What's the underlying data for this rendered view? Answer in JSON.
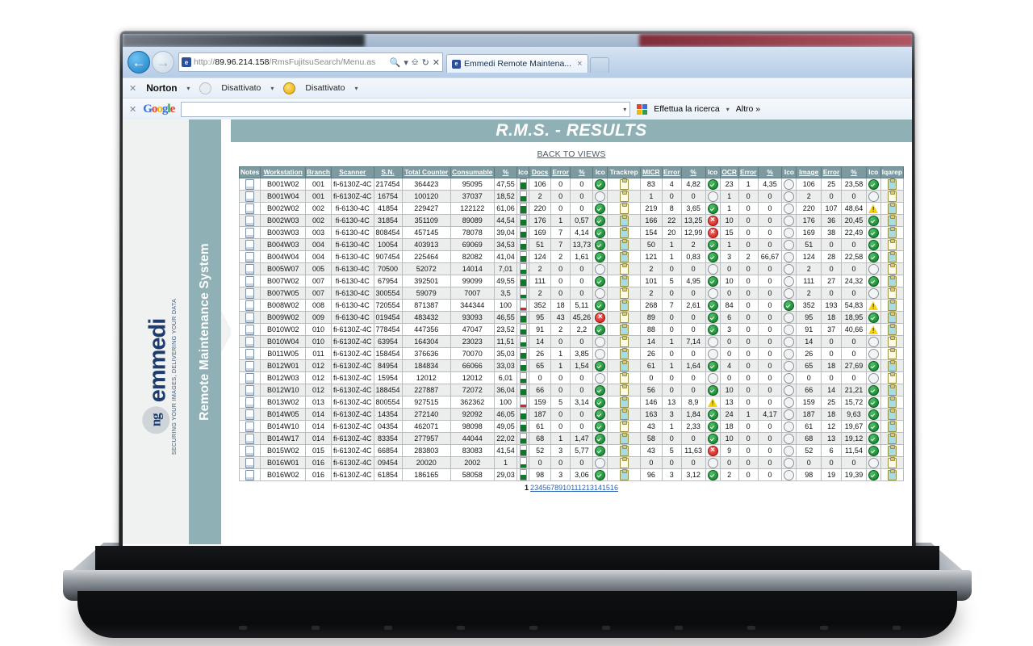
{
  "browser": {
    "address_url_prefix": "http://",
    "address_url_host": "89.96.214.158",
    "address_url_path": "/RmsFujitsuSearch/Menu.as",
    "tab_title": "Emmedi Remote Maintena...",
    "tab_close": "×",
    "nav_back": "←",
    "nav_forward": "→",
    "addr_search_icon": "search-icon",
    "addr_compat_icon": "compatibility-icon",
    "addr_refresh_icon": "↻",
    "addr_stop_icon": "✕",
    "norton": {
      "close": "✕",
      "brand": "Norton",
      "brand_o": "o",
      "brand_tail": "rton",
      "item1": "Disattivato",
      "item2": "Disattivato",
      "caret": "▾"
    },
    "google": {
      "close": "✕",
      "logo_g1": "G",
      "logo_o1": "o",
      "logo_o2": "o",
      "logo_g2": "g",
      "logo_l": "l",
      "logo_e": "e",
      "search_value": "",
      "search_placeholder": "",
      "dropdown_caret": "▾",
      "search_button": "Effettua la ricerca",
      "more": "Altro »"
    }
  },
  "sidebar": {
    "logo_mark": "ng",
    "logo_text": "emmedi",
    "tagline": "SECURING YOUR IMAGES, DELIVERING YOUR DATA",
    "rail_label": "Remote Maintenance System"
  },
  "page": {
    "title": "R.M.S. - RESULTS",
    "back_link": "BACK TO VIEWS"
  },
  "table": {
    "headers": [
      "Notes",
      "Workstation",
      "Branch",
      "Scanner",
      "S.N.",
      "Total Counter",
      "Consumable",
      "%",
      "Ico",
      "Docs",
      "Error",
      "%",
      "Ico",
      "Trackrep",
      "MICR",
      "Error",
      "%",
      "Ico",
      "OCR",
      "Error",
      "%",
      "Ico",
      "Image",
      "Error",
      "%",
      "Ico",
      "Iqarep"
    ],
    "rows": [
      {
        "ws": "B001W02",
        "branch": "001",
        "scanner": "fi-6130Z-4C",
        "sn": "217454",
        "total": "364423",
        "cons": "95095",
        "cons_pct": "47,55",
        "gauge": "green",
        "docs": "106",
        "docs_err": "0",
        "docs_pct": "0",
        "docs_ico": "ok",
        "trackrep": "tan",
        "micr": "83",
        "micr_err": "4",
        "micr_pct": "4,82",
        "micr_ico": "ok",
        "ocr": "23",
        "ocr_err": "1",
        "ocr_pct": "4,35",
        "ocr_ico": "none",
        "img": "106",
        "img_err": "25",
        "img_pct": "23,58",
        "img_ico": "ok",
        "iqarep": "filled"
      },
      {
        "ws": "B001W04",
        "branch": "001",
        "scanner": "fi-6130Z-4C",
        "sn": "16754",
        "total": "100120",
        "cons": "37037",
        "cons_pct": "18,52",
        "gauge": "green",
        "docs": "2",
        "docs_err": "0",
        "docs_pct": "0",
        "docs_ico": "none",
        "trackrep": "tan",
        "micr": "1",
        "micr_err": "0",
        "micr_pct": "0",
        "micr_ico": "none",
        "ocr": "1",
        "ocr_err": "0",
        "ocr_pct": "0",
        "ocr_ico": "none",
        "img": "2",
        "img_err": "0",
        "img_pct": "0",
        "img_ico": "none",
        "iqarep": "tan"
      },
      {
        "ws": "B002W02",
        "branch": "002",
        "scanner": "fi-6130-4C",
        "sn": "41854",
        "total": "229427",
        "cons": "122122",
        "cons_pct": "61,06",
        "gauge": "green",
        "docs": "220",
        "docs_err": "0",
        "docs_pct": "0",
        "docs_ico": "ok",
        "trackrep": "tan",
        "micr": "219",
        "micr_err": "8",
        "micr_pct": "3,65",
        "micr_ico": "ok",
        "ocr": "1",
        "ocr_err": "0",
        "ocr_pct": "0",
        "ocr_ico": "none",
        "img": "220",
        "img_err": "107",
        "img_pct": "48,64",
        "img_ico": "warn",
        "iqarep": "filled"
      },
      {
        "ws": "B002W03",
        "branch": "002",
        "scanner": "fi-6130-4C",
        "sn": "31854",
        "total": "351109",
        "cons": "89089",
        "cons_pct": "44,54",
        "gauge": "green",
        "docs": "176",
        "docs_err": "1",
        "docs_pct": "0,57",
        "docs_ico": "ok",
        "trackrep": "filled",
        "micr": "166",
        "micr_err": "22",
        "micr_pct": "13,25",
        "micr_ico": "err",
        "ocr": "10",
        "ocr_err": "0",
        "ocr_pct": "0",
        "ocr_ico": "none",
        "img": "176",
        "img_err": "36",
        "img_pct": "20,45",
        "img_ico": "ok",
        "iqarep": "filled"
      },
      {
        "ws": "B003W03",
        "branch": "003",
        "scanner": "fi-6130-4C",
        "sn": "808454",
        "total": "457145",
        "cons": "78078",
        "cons_pct": "39,04",
        "gauge": "green",
        "docs": "169",
        "docs_err": "7",
        "docs_pct": "4,14",
        "docs_ico": "ok",
        "trackrep": "filled",
        "micr": "154",
        "micr_err": "20",
        "micr_pct": "12,99",
        "micr_ico": "err",
        "ocr": "15",
        "ocr_err": "0",
        "ocr_pct": "0",
        "ocr_ico": "none",
        "img": "169",
        "img_err": "38",
        "img_pct": "22,49",
        "img_ico": "ok",
        "iqarep": "filled"
      },
      {
        "ws": "B004W03",
        "branch": "004",
        "scanner": "fi-6130-4C",
        "sn": "10054",
        "total": "403913",
        "cons": "69069",
        "cons_pct": "34,53",
        "gauge": "green",
        "docs": "51",
        "docs_err": "7",
        "docs_pct": "13,73",
        "docs_ico": "ok",
        "trackrep": "filled",
        "micr": "50",
        "micr_err": "1",
        "micr_pct": "2",
        "micr_ico": "ok",
        "ocr": "1",
        "ocr_err": "0",
        "ocr_pct": "0",
        "ocr_ico": "none",
        "img": "51",
        "img_err": "0",
        "img_pct": "0",
        "img_ico": "ok",
        "iqarep": "tan"
      },
      {
        "ws": "B004W04",
        "branch": "004",
        "scanner": "fi-6130-4C",
        "sn": "907454",
        "total": "225464",
        "cons": "82082",
        "cons_pct": "41,04",
        "gauge": "green",
        "docs": "124",
        "docs_err": "2",
        "docs_pct": "1,61",
        "docs_ico": "ok",
        "trackrep": "filled",
        "micr": "121",
        "micr_err": "1",
        "micr_pct": "0,83",
        "micr_ico": "ok",
        "ocr": "3",
        "ocr_err": "2",
        "ocr_pct": "66,67",
        "ocr_ico": "none",
        "img": "124",
        "img_err": "28",
        "img_pct": "22,58",
        "img_ico": "ok",
        "iqarep": "filled"
      },
      {
        "ws": "B005W07",
        "branch": "005",
        "scanner": "fi-6130-4C",
        "sn": "70500",
        "total": "52072",
        "cons": "14014",
        "cons_pct": "7,01",
        "gauge": "green",
        "docs": "2",
        "docs_err": "0",
        "docs_pct": "0",
        "docs_ico": "none",
        "trackrep": "tan",
        "micr": "2",
        "micr_err": "0",
        "micr_pct": "0",
        "micr_ico": "none",
        "ocr": "0",
        "ocr_err": "0",
        "ocr_pct": "0",
        "ocr_ico": "none",
        "img": "2",
        "img_err": "0",
        "img_pct": "0",
        "img_ico": "none",
        "iqarep": "tan"
      },
      {
        "ws": "B007W02",
        "branch": "007",
        "scanner": "fi-6130-4C",
        "sn": "67954",
        "total": "392501",
        "cons": "99099",
        "cons_pct": "49,55",
        "gauge": "green",
        "docs": "111",
        "docs_err": "0",
        "docs_pct": "0",
        "docs_ico": "ok",
        "trackrep": "filled",
        "micr": "101",
        "micr_err": "5",
        "micr_pct": "4,95",
        "micr_ico": "ok",
        "ocr": "10",
        "ocr_err": "0",
        "ocr_pct": "0",
        "ocr_ico": "none",
        "img": "111",
        "img_err": "27",
        "img_pct": "24,32",
        "img_ico": "ok",
        "iqarep": "filled"
      },
      {
        "ws": "B007W05",
        "branch": "007",
        "scanner": "fi-6130-4C",
        "sn": "300554",
        "total": "59079",
        "cons": "7007",
        "cons_pct": "3,5",
        "gauge": "green",
        "docs": "2",
        "docs_err": "0",
        "docs_pct": "0",
        "docs_ico": "none",
        "trackrep": "tan",
        "micr": "2",
        "micr_err": "0",
        "micr_pct": "0",
        "micr_ico": "none",
        "ocr": "0",
        "ocr_err": "0",
        "ocr_pct": "0",
        "ocr_ico": "none",
        "img": "2",
        "img_err": "0",
        "img_pct": "0",
        "img_ico": "none",
        "iqarep": "tan"
      },
      {
        "ws": "B008W02",
        "branch": "008",
        "scanner": "fi-6130-4C",
        "sn": "720554",
        "total": "871387",
        "cons": "344344",
        "cons_pct": "100",
        "gauge": "full",
        "docs": "352",
        "docs_err": "18",
        "docs_pct": "5,11",
        "docs_ico": "ok",
        "trackrep": "filled",
        "micr": "268",
        "micr_err": "7",
        "micr_pct": "2,61",
        "micr_ico": "ok",
        "ocr": "84",
        "ocr_err": "0",
        "ocr_pct": "0",
        "ocr_ico": "ok",
        "img": "352",
        "img_err": "193",
        "img_pct": "54,83",
        "img_ico": "warn",
        "iqarep": "filled"
      },
      {
        "ws": "B009W02",
        "branch": "009",
        "scanner": "fi-6130-4C",
        "sn": "019454",
        "total": "483432",
        "cons": "93093",
        "cons_pct": "46,55",
        "gauge": "green",
        "docs": "95",
        "docs_err": "43",
        "docs_pct": "45,26",
        "docs_ico": "err",
        "trackrep": "tan",
        "micr": "89",
        "micr_err": "0",
        "micr_pct": "0",
        "micr_ico": "ok",
        "ocr": "6",
        "ocr_err": "0",
        "ocr_pct": "0",
        "ocr_ico": "none",
        "img": "95",
        "img_err": "18",
        "img_pct": "18,95",
        "img_ico": "ok",
        "iqarep": "filled"
      },
      {
        "ws": "B010W02",
        "branch": "010",
        "scanner": "fi-6130Z-4C",
        "sn": "778454",
        "total": "447356",
        "cons": "47047",
        "cons_pct": "23,52",
        "gauge": "green",
        "docs": "91",
        "docs_err": "2",
        "docs_pct": "2,2",
        "docs_ico": "ok",
        "trackrep": "filled",
        "micr": "88",
        "micr_err": "0",
        "micr_pct": "0",
        "micr_ico": "ok",
        "ocr": "3",
        "ocr_err": "0",
        "ocr_pct": "0",
        "ocr_ico": "none",
        "img": "91",
        "img_err": "37",
        "img_pct": "40,66",
        "img_ico": "warn",
        "iqarep": "filled"
      },
      {
        "ws": "B010W04",
        "branch": "010",
        "scanner": "fi-6130Z-4C",
        "sn": "63954",
        "total": "164304",
        "cons": "23023",
        "cons_pct": "11,51",
        "gauge": "green",
        "docs": "14",
        "docs_err": "0",
        "docs_pct": "0",
        "docs_ico": "none",
        "trackrep": "tan",
        "micr": "14",
        "micr_err": "1",
        "micr_pct": "7,14",
        "micr_ico": "none",
        "ocr": "0",
        "ocr_err": "0",
        "ocr_pct": "0",
        "ocr_ico": "none",
        "img": "14",
        "img_err": "0",
        "img_pct": "0",
        "img_ico": "none",
        "iqarep": "tan"
      },
      {
        "ws": "B011W05",
        "branch": "011",
        "scanner": "fi-6130Z-4C",
        "sn": "158454",
        "total": "376636",
        "cons": "70070",
        "cons_pct": "35,03",
        "gauge": "green",
        "docs": "26",
        "docs_err": "1",
        "docs_pct": "3,85",
        "docs_ico": "none",
        "trackrep": "filled",
        "micr": "26",
        "micr_err": "0",
        "micr_pct": "0",
        "micr_ico": "none",
        "ocr": "0",
        "ocr_err": "0",
        "ocr_pct": "0",
        "ocr_ico": "none",
        "img": "26",
        "img_err": "0",
        "img_pct": "0",
        "img_ico": "none",
        "iqarep": "tan"
      },
      {
        "ws": "B012W01",
        "branch": "012",
        "scanner": "fi-6130Z-4C",
        "sn": "84954",
        "total": "184834",
        "cons": "66066",
        "cons_pct": "33,03",
        "gauge": "green",
        "docs": "65",
        "docs_err": "1",
        "docs_pct": "1,54",
        "docs_ico": "ok",
        "trackrep": "filled",
        "micr": "61",
        "micr_err": "1",
        "micr_pct": "1,64",
        "micr_ico": "ok",
        "ocr": "4",
        "ocr_err": "0",
        "ocr_pct": "0",
        "ocr_ico": "none",
        "img": "65",
        "img_err": "18",
        "img_pct": "27,69",
        "img_ico": "ok",
        "iqarep": "filled"
      },
      {
        "ws": "B012W03",
        "branch": "012",
        "scanner": "fi-6130Z-4C",
        "sn": "15954",
        "total": "12012",
        "cons": "12012",
        "cons_pct": "6,01",
        "gauge": "green",
        "docs": "0",
        "docs_err": "0",
        "docs_pct": "0",
        "docs_ico": "none",
        "trackrep": "tan",
        "micr": "0",
        "micr_err": "0",
        "micr_pct": "0",
        "micr_ico": "none",
        "ocr": "0",
        "ocr_err": "0",
        "ocr_pct": "0",
        "ocr_ico": "none",
        "img": "0",
        "img_err": "0",
        "img_pct": "0",
        "img_ico": "none",
        "iqarep": "tan"
      },
      {
        "ws": "B012W10",
        "branch": "012",
        "scanner": "fi-6130Z-4C",
        "sn": "188454",
        "total": "227887",
        "cons": "72072",
        "cons_pct": "36,04",
        "gauge": "green",
        "docs": "66",
        "docs_err": "0",
        "docs_pct": "0",
        "docs_ico": "ok",
        "trackrep": "tan",
        "micr": "56",
        "micr_err": "0",
        "micr_pct": "0",
        "micr_ico": "ok",
        "ocr": "10",
        "ocr_err": "0",
        "ocr_pct": "0",
        "ocr_ico": "none",
        "img": "66",
        "img_err": "14",
        "img_pct": "21,21",
        "img_ico": "ok",
        "iqarep": "filled"
      },
      {
        "ws": "B013W02",
        "branch": "013",
        "scanner": "fi-6130Z-4C",
        "sn": "800554",
        "total": "927515",
        "cons": "362362",
        "cons_pct": "100",
        "gauge": "full",
        "docs": "159",
        "docs_err": "5",
        "docs_pct": "3,14",
        "docs_ico": "ok",
        "trackrep": "filled",
        "micr": "146",
        "micr_err": "13",
        "micr_pct": "8,9",
        "micr_ico": "warn",
        "ocr": "13",
        "ocr_err": "0",
        "ocr_pct": "0",
        "ocr_ico": "none",
        "img": "159",
        "img_err": "25",
        "img_pct": "15,72",
        "img_ico": "ok",
        "iqarep": "filled"
      },
      {
        "ws": "B014W05",
        "branch": "014",
        "scanner": "fi-6130Z-4C",
        "sn": "14354",
        "total": "272140",
        "cons": "92092",
        "cons_pct": "46,05",
        "gauge": "green",
        "docs": "187",
        "docs_err": "0",
        "docs_pct": "0",
        "docs_ico": "ok",
        "trackrep": "filled",
        "micr": "163",
        "micr_err": "3",
        "micr_pct": "1,84",
        "micr_ico": "ok",
        "ocr": "24",
        "ocr_err": "1",
        "ocr_pct": "4,17",
        "ocr_ico": "none",
        "img": "187",
        "img_err": "18",
        "img_pct": "9,63",
        "img_ico": "ok",
        "iqarep": "filled"
      },
      {
        "ws": "B014W10",
        "branch": "014",
        "scanner": "fi-6130Z-4C",
        "sn": "04354",
        "total": "462071",
        "cons": "98098",
        "cons_pct": "49,05",
        "gauge": "green",
        "docs": "61",
        "docs_err": "0",
        "docs_pct": "0",
        "docs_ico": "ok",
        "trackrep": "tan",
        "micr": "43",
        "micr_err": "1",
        "micr_pct": "2,33",
        "micr_ico": "ok",
        "ocr": "18",
        "ocr_err": "0",
        "ocr_pct": "0",
        "ocr_ico": "none",
        "img": "61",
        "img_err": "12",
        "img_pct": "19,67",
        "img_ico": "ok",
        "iqarep": "filled"
      },
      {
        "ws": "B014W17",
        "branch": "014",
        "scanner": "fi-6130Z-4C",
        "sn": "83354",
        "total": "277957",
        "cons": "44044",
        "cons_pct": "22,02",
        "gauge": "green",
        "docs": "68",
        "docs_err": "1",
        "docs_pct": "1,47",
        "docs_ico": "ok",
        "trackrep": "filled",
        "micr": "58",
        "micr_err": "0",
        "micr_pct": "0",
        "micr_ico": "ok",
        "ocr": "10",
        "ocr_err": "0",
        "ocr_pct": "0",
        "ocr_ico": "none",
        "img": "68",
        "img_err": "13",
        "img_pct": "19,12",
        "img_ico": "ok",
        "iqarep": "filled"
      },
      {
        "ws": "B015W02",
        "branch": "015",
        "scanner": "fi-6130Z-4C",
        "sn": "66854",
        "total": "283803",
        "cons": "83083",
        "cons_pct": "41,54",
        "gauge": "green",
        "docs": "52",
        "docs_err": "3",
        "docs_pct": "5,77",
        "docs_ico": "ok",
        "trackrep": "filled",
        "micr": "43",
        "micr_err": "5",
        "micr_pct": "11,63",
        "micr_ico": "err",
        "ocr": "9",
        "ocr_err": "0",
        "ocr_pct": "0",
        "ocr_ico": "none",
        "img": "52",
        "img_err": "6",
        "img_pct": "11,54",
        "img_ico": "ok",
        "iqarep": "filled"
      },
      {
        "ws": "B016W01",
        "branch": "016",
        "scanner": "fi-6130Z-4C",
        "sn": "09454",
        "total": "20020",
        "cons": "2002",
        "cons_pct": "1",
        "gauge": "green",
        "docs": "0",
        "docs_err": "0",
        "docs_pct": "0",
        "docs_ico": "none",
        "trackrep": "tan",
        "micr": "0",
        "micr_err": "0",
        "micr_pct": "0",
        "micr_ico": "none",
        "ocr": "0",
        "ocr_err": "0",
        "ocr_pct": "0",
        "ocr_ico": "none",
        "img": "0",
        "img_err": "0",
        "img_pct": "0",
        "img_ico": "none",
        "iqarep": "tan"
      },
      {
        "ws": "B016W02",
        "branch": "016",
        "scanner": "fi-6130Z-4C",
        "sn": "61854",
        "total": "186165",
        "cons": "58058",
        "cons_pct": "29,03",
        "gauge": "green",
        "docs": "98",
        "docs_err": "3",
        "docs_pct": "3,06",
        "docs_ico": "ok",
        "trackrep": "filled",
        "micr": "96",
        "micr_err": "3",
        "micr_pct": "3,12",
        "micr_ico": "ok",
        "ocr": "2",
        "ocr_err": "0",
        "ocr_pct": "0",
        "ocr_ico": "none",
        "img": "98",
        "img_err": "19",
        "img_pct": "19,39",
        "img_ico": "ok",
        "iqarep": "filled"
      }
    ]
  },
  "pagination": {
    "current": "1",
    "pages": [
      "2",
      "3",
      "4",
      "5",
      "6",
      "7",
      "8",
      "9",
      "10",
      "11",
      "12",
      "13",
      "14",
      "15",
      "16"
    ]
  },
  "colors": {
    "brand_teal": "#8fb0b4",
    "header_teal": "#7d9aa0",
    "logo_blue": "#1d3c6e",
    "ok_green": "#0a7a25",
    "err_red": "#cc1414",
    "warn_yellow": "#f5d20a",
    "link_blue": "#2b5fb0"
  }
}
